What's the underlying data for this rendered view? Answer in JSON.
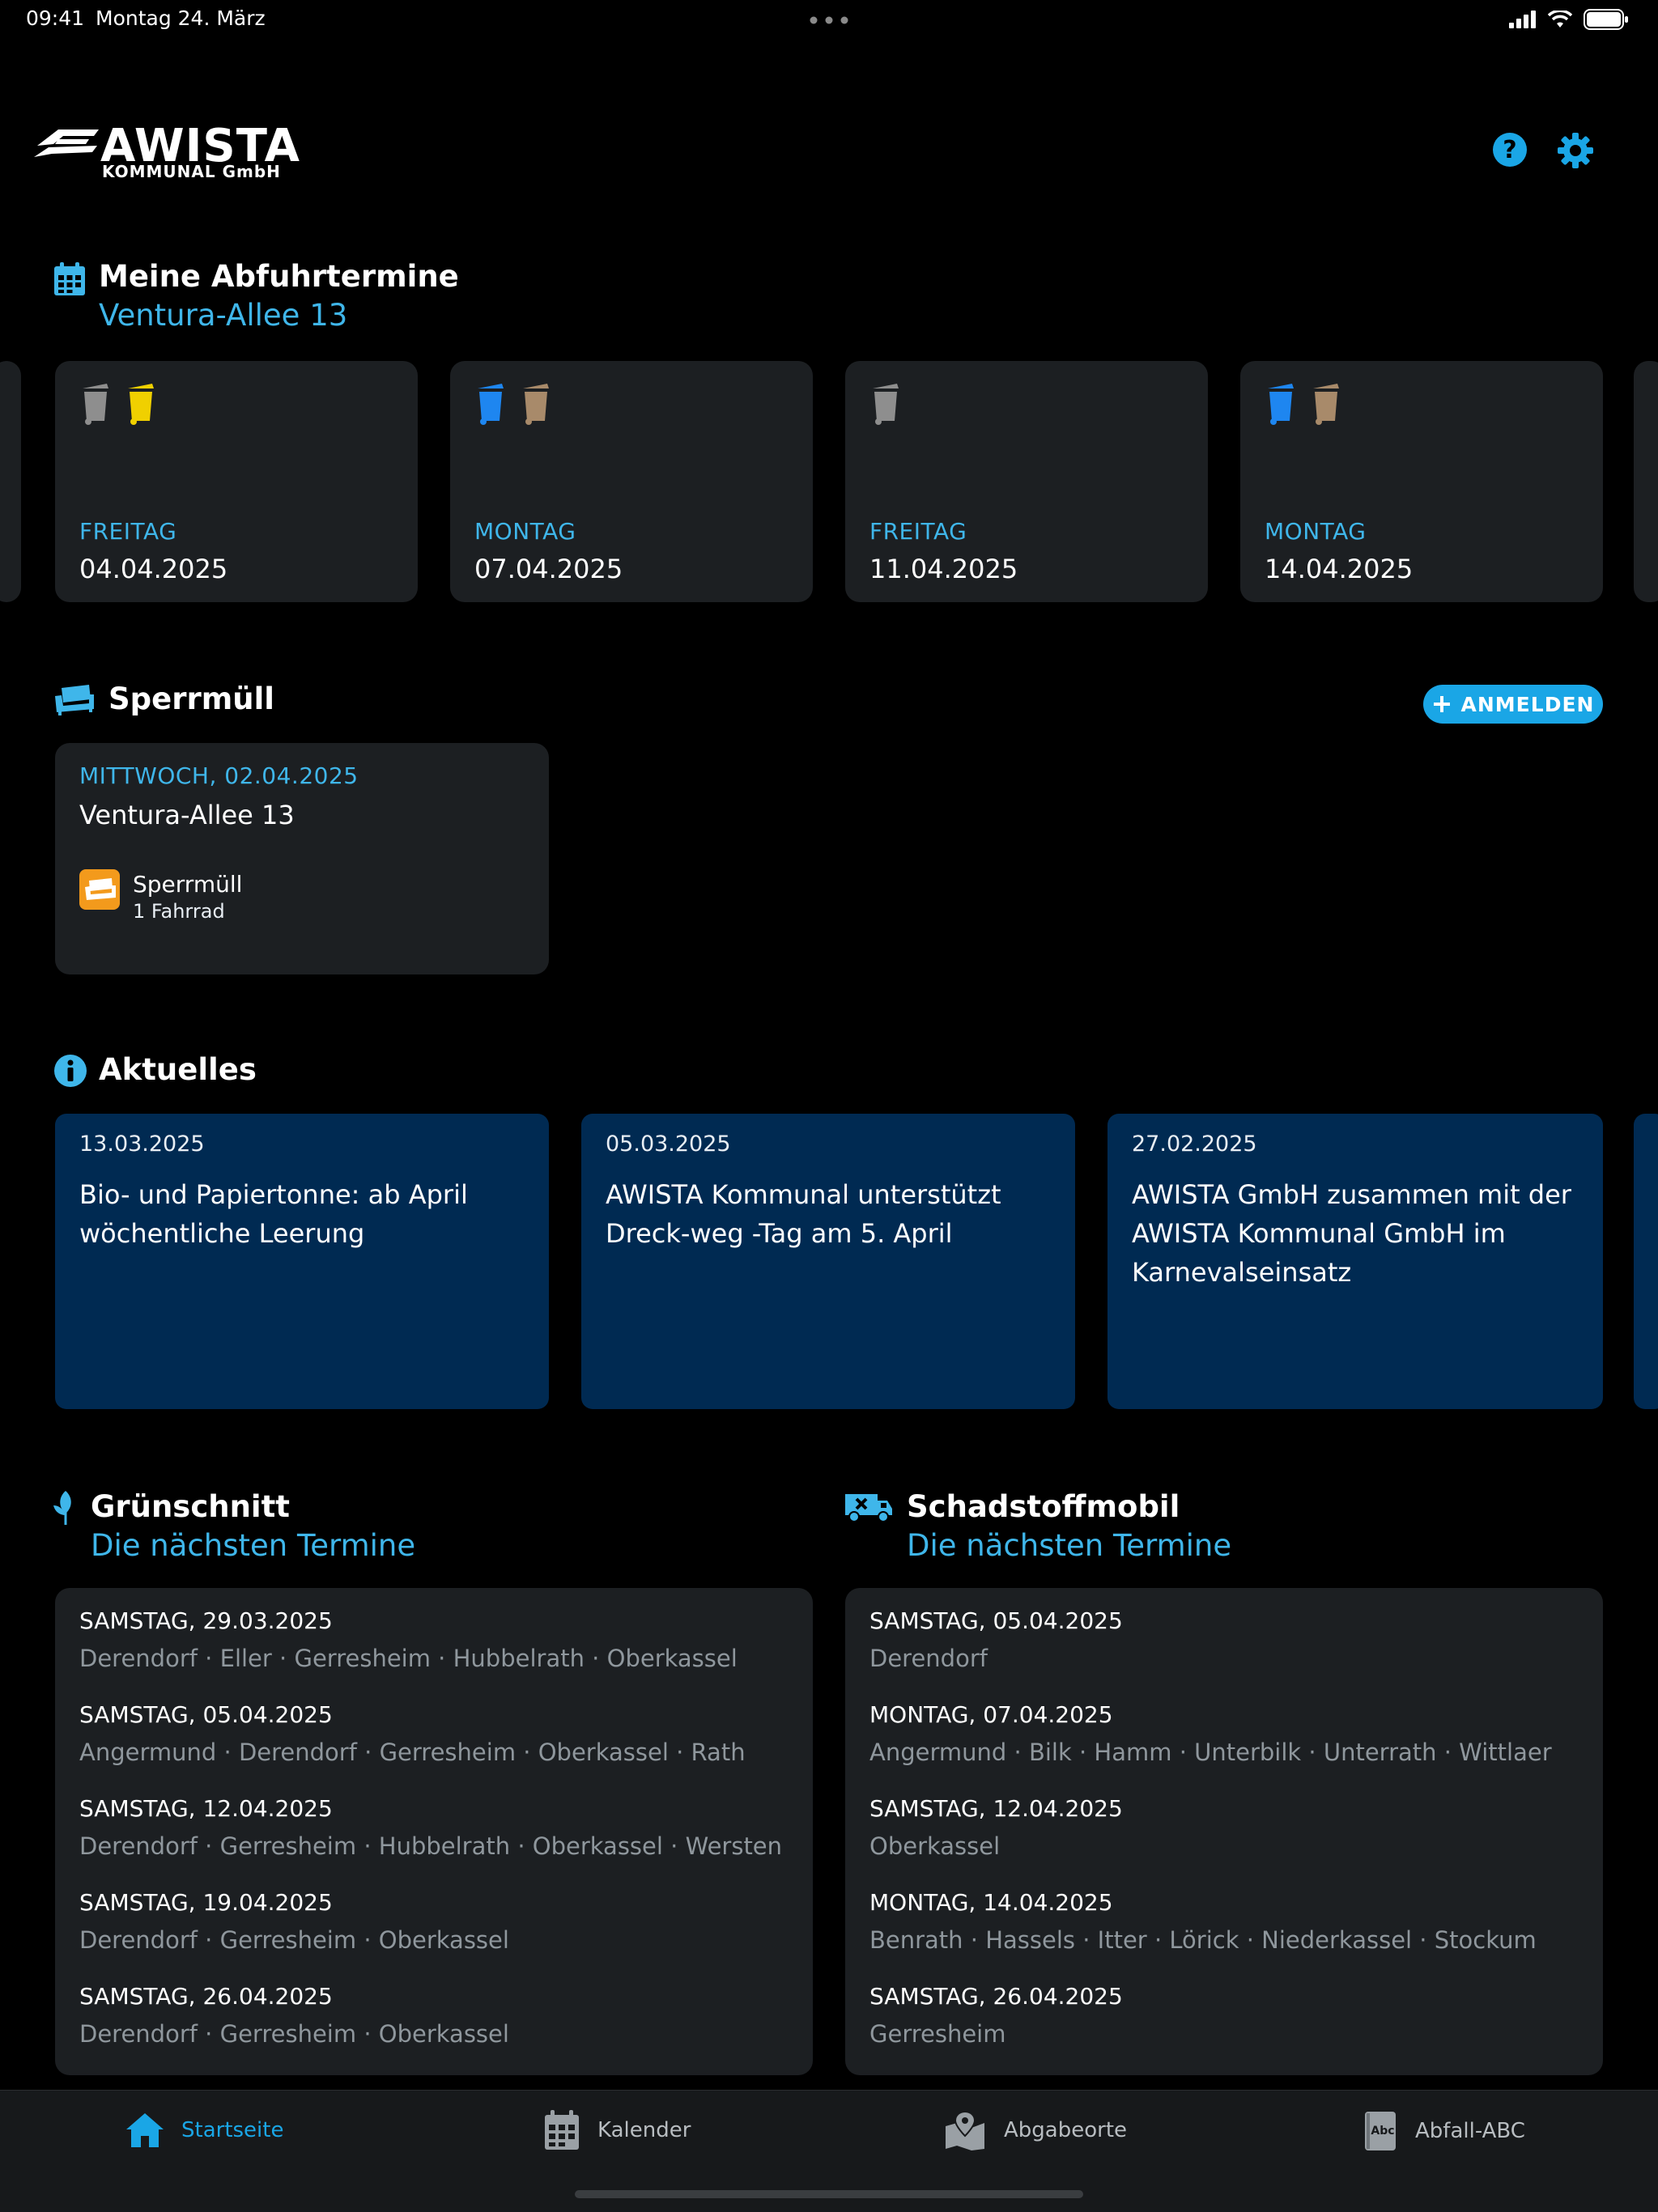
{
  "status_bar": {
    "time": "09:41",
    "date": "Montag 24. März"
  },
  "brand": {
    "name": "AWISTA",
    "sub": "KOMMUNAL GmbH"
  },
  "colors": {
    "accent": "#3fb6ea",
    "card_bg": "#1c1f22",
    "news_bg": "#002a52",
    "bin_grey": "#8e8e8e",
    "bin_yellow": "#f0d000",
    "bin_blue": "#1e86f0",
    "bin_brown": "#a88a6a",
    "bulky_orange": "#f39a1c"
  },
  "header": {
    "help_icon": "help-icon",
    "settings_icon": "gear-icon"
  },
  "abfuhr": {
    "title": "Meine Abfuhrtermine",
    "address": "Ventura-Allee 13",
    "items": [
      {
        "weekday": "FREITAG",
        "date": "04.04.2025",
        "bins": [
          "grey",
          "yellow"
        ]
      },
      {
        "weekday": "MONTAG",
        "date": "07.04.2025",
        "bins": [
          "blue",
          "brown"
        ]
      },
      {
        "weekday": "FREITAG",
        "date": "11.04.2025",
        "bins": [
          "grey"
        ]
      },
      {
        "weekday": "MONTAG",
        "date": "14.04.2025",
        "bins": [
          "blue",
          "brown"
        ]
      }
    ]
  },
  "sperrmuell": {
    "title": "Sperrmüll",
    "button": "ANMELDEN",
    "entry": {
      "date": "MITTWOCH, 02.04.2025",
      "address": "Ventura-Allee 13",
      "item_title": "Sperrmüll",
      "item_detail": "1 Fahrrad"
    }
  },
  "aktuelles": {
    "title": "Aktuelles",
    "items": [
      {
        "date": "13.03.2025",
        "title": "Bio- und Papiertonne: ab April wöchentliche Leerung"
      },
      {
        "date": "05.03.2025",
        "title": "AWISTA Kommunal unterstützt Dreck-weg -Tag am 5. April"
      },
      {
        "date": "27.02.2025",
        "title": "AWISTA GmbH zusammen mit der AWISTA Kommunal GmbH im Karnevalseinsatz"
      }
    ]
  },
  "gruenschnitt": {
    "title": "Grünschnitt",
    "subtitle": "Die nächsten Termine",
    "items": [
      {
        "date": "SAMSTAG, 29.03.2025",
        "places": "Derendorf · Eller · Gerresheim · Hubbelrath · Oberkassel"
      },
      {
        "date": "SAMSTAG, 05.04.2025",
        "places": "Angermund · Derendorf · Gerresheim · Oberkassel · Rath"
      },
      {
        "date": "SAMSTAG, 12.04.2025",
        "places": "Derendorf · Gerresheim · Hubbelrath · Oberkassel · Wersten"
      },
      {
        "date": "SAMSTAG, 19.04.2025",
        "places": "Derendorf · Gerresheim · Oberkassel"
      },
      {
        "date": "SAMSTAG, 26.04.2025",
        "places": "Derendorf · Gerresheim · Oberkassel"
      }
    ]
  },
  "schadstoff": {
    "title": "Schadstoffmobil",
    "subtitle": "Die nächsten Termine",
    "items": [
      {
        "date": "SAMSTAG, 05.04.2025",
        "places": "Derendorf"
      },
      {
        "date": "MONTAG, 07.04.2025",
        "places": "Angermund · Bilk · Hamm · Unterbilk · Unterrath · Wittlaer"
      },
      {
        "date": "SAMSTAG, 12.04.2025",
        "places": "Oberkassel"
      },
      {
        "date": "MONTAG, 14.04.2025",
        "places": "Benrath · Hassels · Itter · Lörick · Niederkassel · Stockum"
      },
      {
        "date": "SAMSTAG, 26.04.2025",
        "places": "Gerresheim"
      }
    ]
  },
  "tabs": [
    {
      "label": "Startseite",
      "icon": "home-icon",
      "active": true
    },
    {
      "label": "Kalender",
      "icon": "calendar-icon",
      "active": false
    },
    {
      "label": "Abgabeorte",
      "icon": "map-pin-icon",
      "active": false
    },
    {
      "label": "Abfall-ABC",
      "icon": "abc-book-icon",
      "active": false
    }
  ]
}
